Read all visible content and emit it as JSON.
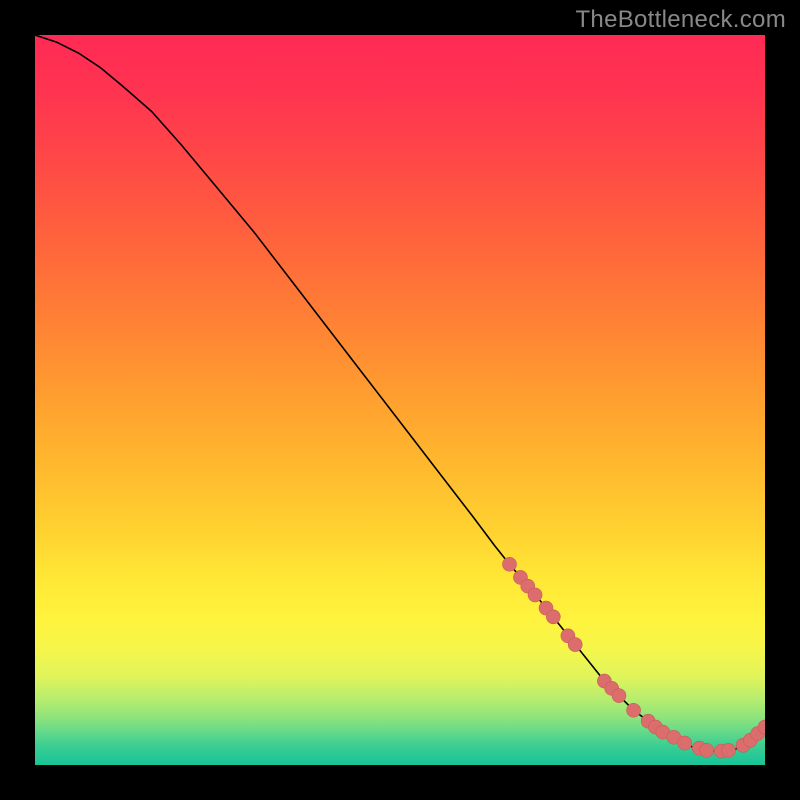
{
  "watermark": "TheBottleneck.com",
  "colors": {
    "background": "#000000",
    "watermark_text": "#888888",
    "curve": "#000000",
    "marker_fill": "#db6e6c",
    "marker_stroke": "#c95a58",
    "gradient_stops": [
      {
        "offset": 0.0,
        "color": "#ff2a55"
      },
      {
        "offset": 0.08,
        "color": "#ff3450"
      },
      {
        "offset": 0.18,
        "color": "#ff4a46"
      },
      {
        "offset": 0.28,
        "color": "#ff633c"
      },
      {
        "offset": 0.38,
        "color": "#ff7e35"
      },
      {
        "offset": 0.48,
        "color": "#ff9a30"
      },
      {
        "offset": 0.58,
        "color": "#ffb62e"
      },
      {
        "offset": 0.68,
        "color": "#ffd230"
      },
      {
        "offset": 0.74,
        "color": "#ffe636"
      },
      {
        "offset": 0.8,
        "color": "#fff33d"
      },
      {
        "offset": 0.84,
        "color": "#f6f64a"
      },
      {
        "offset": 0.88,
        "color": "#dff45c"
      },
      {
        "offset": 0.91,
        "color": "#b6ed6e"
      },
      {
        "offset": 0.935,
        "color": "#8ee37c"
      },
      {
        "offset": 0.955,
        "color": "#63d98a"
      },
      {
        "offset": 0.975,
        "color": "#3acd93"
      },
      {
        "offset": 1.0,
        "color": "#17c497"
      }
    ]
  },
  "chart_data": {
    "type": "line",
    "title": "",
    "xlabel": "",
    "ylabel": "",
    "xlim": [
      0,
      100
    ],
    "ylim": [
      0,
      100
    ],
    "series": [
      {
        "name": "bottleneck-curve",
        "x": [
          0,
          3,
          6,
          9,
          12,
          16,
          20,
          25,
          30,
          35,
          40,
          45,
          50,
          55,
          60,
          63,
          65,
          68,
          70,
          72,
          74,
          76,
          78,
          80,
          82,
          84,
          86,
          88,
          90,
          92,
          93,
          94,
          95,
          96,
          97,
          98,
          99,
          100
        ],
        "y": [
          100,
          99,
          97.5,
          95.5,
          93,
          89.5,
          85,
          79,
          73,
          66.5,
          60,
          53.5,
          47,
          40.5,
          34,
          30,
          27.5,
          24,
          21.5,
          19,
          16.5,
          14,
          11.5,
          9.5,
          7.5,
          6,
          4.5,
          3.3,
          2.5,
          2.0,
          1.9,
          1.9,
          2.0,
          2.2,
          2.7,
          3.4,
          4.3,
          5.2
        ]
      }
    ],
    "markers": {
      "name": "highlighted-points",
      "x": [
        65,
        66.5,
        67.5,
        68.5,
        70,
        71,
        73,
        74,
        78,
        79,
        80,
        82,
        84,
        85,
        86,
        87.5,
        89,
        91,
        92,
        94,
        95,
        97,
        98,
        99,
        100
      ],
      "y": [
        27.5,
        25.7,
        24.5,
        23.3,
        21.5,
        20.3,
        17.7,
        16.5,
        11.5,
        10.5,
        9.5,
        7.5,
        6,
        5.2,
        4.5,
        3.8,
        3.0,
        2.3,
        2.0,
        1.9,
        2.0,
        2.7,
        3.4,
        4.3,
        5.2
      ]
    }
  }
}
